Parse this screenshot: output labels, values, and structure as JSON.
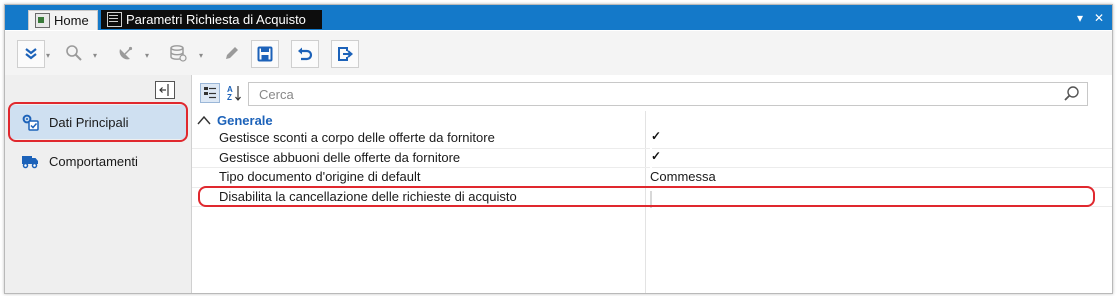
{
  "tabs": [
    {
      "label": "Home",
      "icon": "home-app-icon"
    },
    {
      "label": "Parametri Richiesta di Acquisto",
      "icon": "document-list-icon"
    }
  ],
  "window_controls": {
    "dropdown": "▾",
    "close": "✕"
  },
  "toolbar": {
    "buttons": [
      {
        "name": "expand-menu",
        "icon": "double-chevron-down-icon"
      },
      {
        "name": "search",
        "icon": "search-icon"
      },
      {
        "name": "satellite",
        "icon": "satellite-dish-icon"
      },
      {
        "name": "database",
        "icon": "database-icon"
      },
      {
        "name": "edit",
        "icon": "pencil-icon"
      },
      {
        "name": "save",
        "icon": "save-icon"
      },
      {
        "name": "undo",
        "icon": "undo-icon"
      },
      {
        "name": "exit",
        "icon": "exit-icon"
      }
    ]
  },
  "sidebar": {
    "items": [
      {
        "label": "Dati Principali",
        "icon": "gears-icon",
        "selected": true
      },
      {
        "label": "Comportamenti",
        "icon": "truck-icon",
        "selected": false
      }
    ]
  },
  "properties": {
    "search_placeholder": "Cerca",
    "category": "Generale",
    "rows": [
      {
        "name": "Gestisce sconti a corpo delle offerte da fornitore",
        "type": "checkbox",
        "checked": true
      },
      {
        "name": "Gestisce abbuoni delle offerte da fornitore",
        "type": "checkbox",
        "checked": true
      },
      {
        "name": "Tipo documento d'origine di default",
        "type": "text",
        "value": "Commessa"
      },
      {
        "name": "Disabilita la cancellazione delle richieste di acquisto",
        "type": "checkbox",
        "checked": false
      }
    ]
  },
  "colors": {
    "title_bar": "#1479c9",
    "accent_blue": "#1c62b9",
    "highlight_red": "#e0282e",
    "selected_nav": "#cfe0f1"
  }
}
